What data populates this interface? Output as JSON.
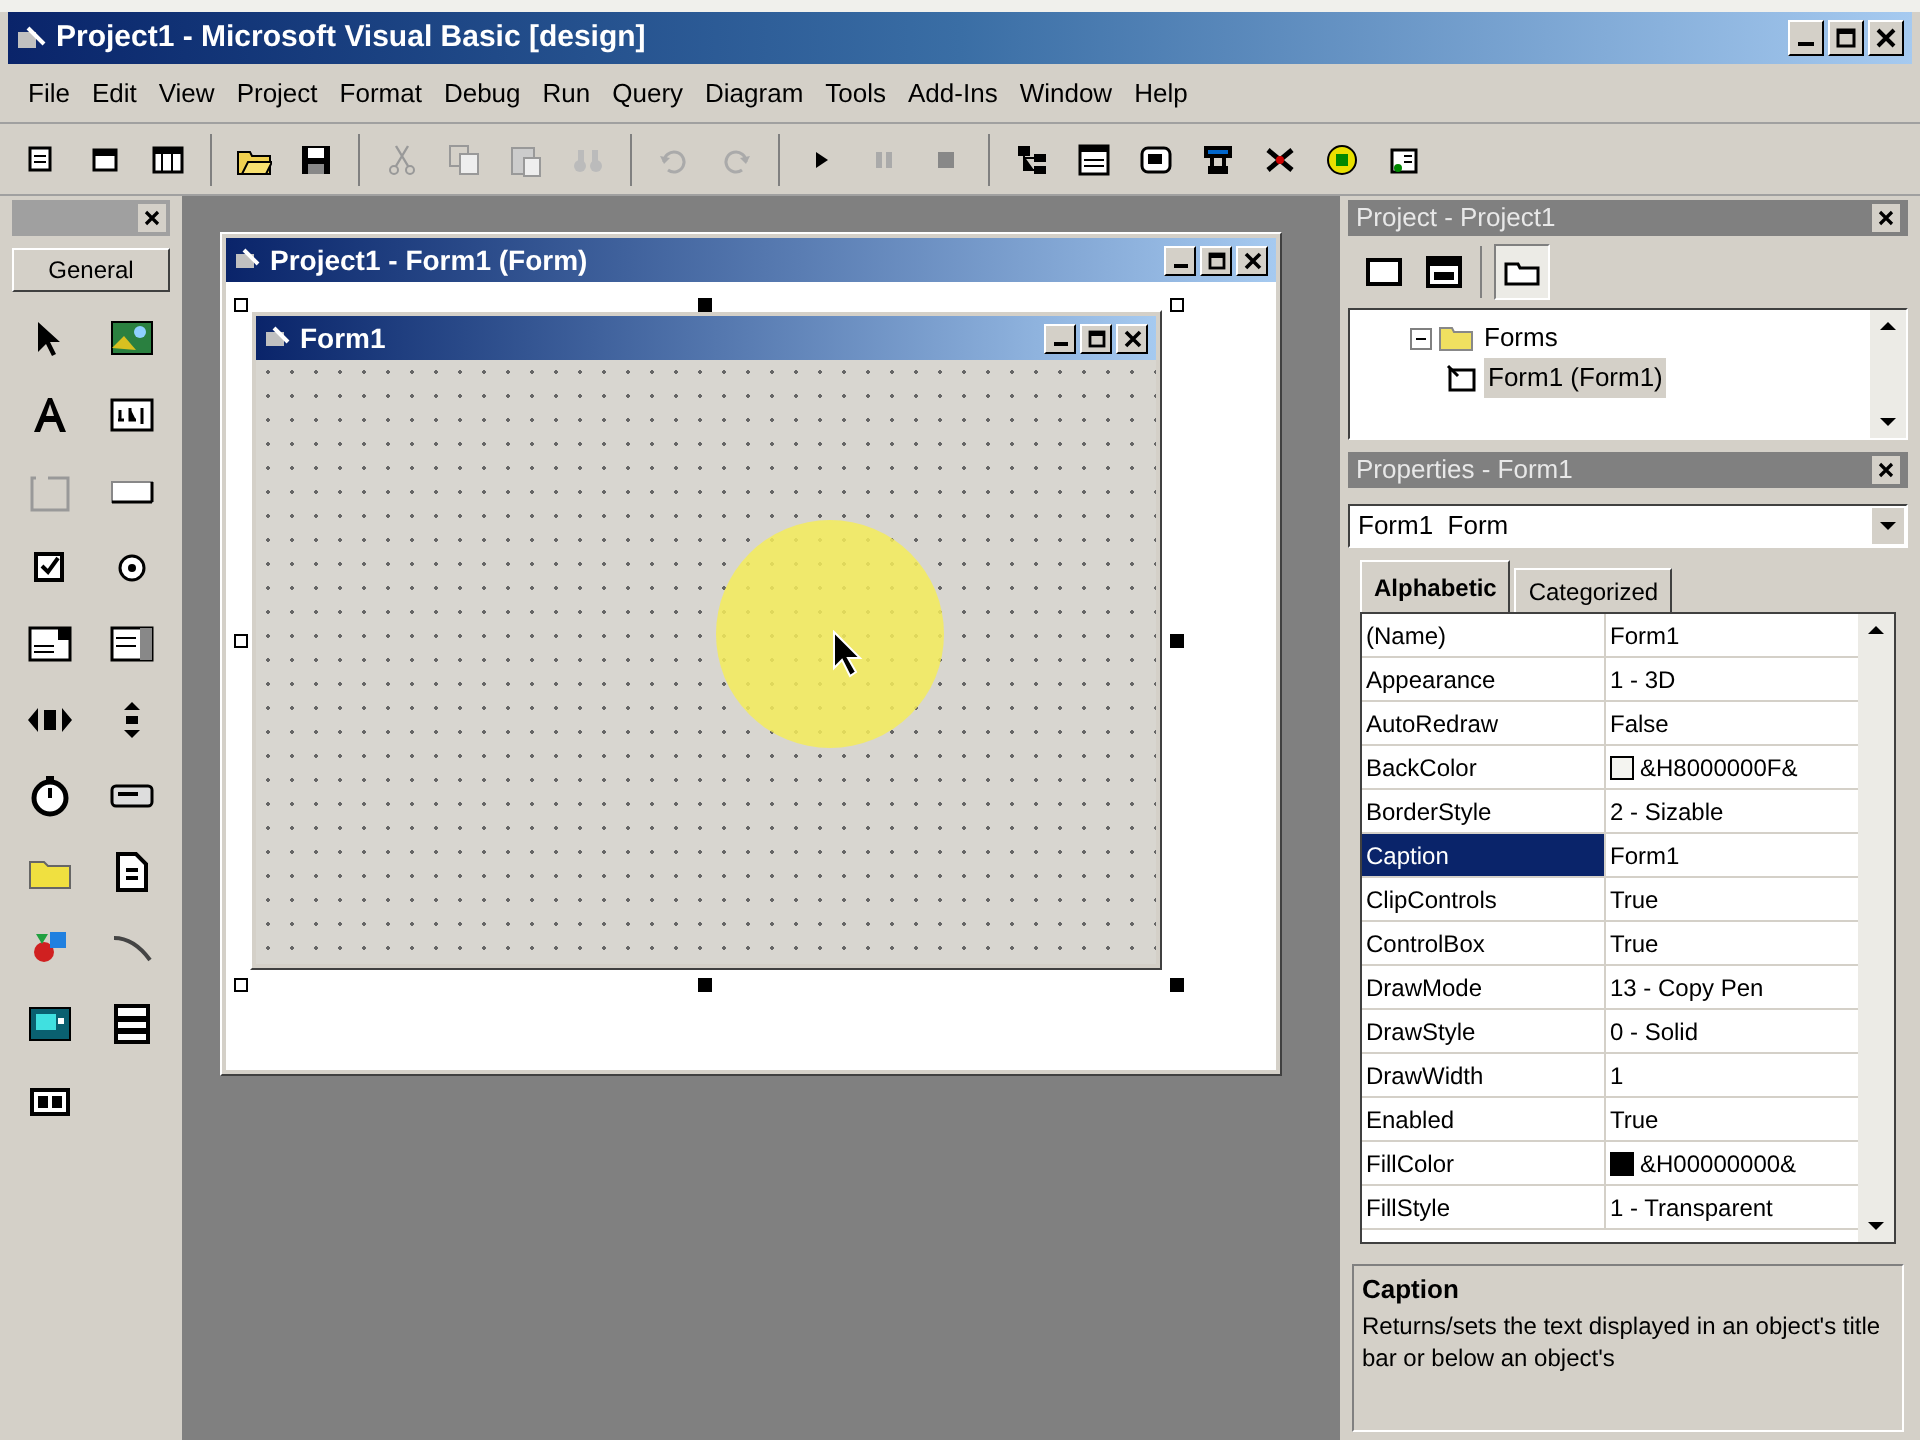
{
  "window": {
    "title": "Project1 - Microsoft Visual Basic [design]"
  },
  "menu": [
    "File",
    "Edit",
    "View",
    "Project",
    "Format",
    "Debug",
    "Run",
    "Query",
    "Diagram",
    "Tools",
    "Add-Ins",
    "Window",
    "Help"
  ],
  "toolbox": {
    "tab": "General"
  },
  "designer": {
    "title": "Project1 - Form1 (Form)",
    "form": {
      "caption": "Form1"
    }
  },
  "project_explorer": {
    "title": "Project - Project1",
    "tree": [
      {
        "label": "Forms",
        "expanded": true,
        "selected": false,
        "children": [
          {
            "label": "Form1 (Form1)",
            "selected": true
          }
        ]
      }
    ]
  },
  "properties": {
    "title": "Properties - Form1",
    "object": "Form1  Form",
    "tabs": [
      {
        "label": "Alphabetic",
        "selected": true
      },
      {
        "label": "Categorized",
        "selected": false
      }
    ],
    "rows": [
      {
        "name": "(Name)",
        "value": "Form1",
        "selected": false
      },
      {
        "name": "Appearance",
        "value": "1 - 3D",
        "selected": false
      },
      {
        "name": "AutoRedraw",
        "value": "False",
        "selected": false
      },
      {
        "name": "BackColor",
        "value": "&H8000000F&",
        "color": "#f4f4f0",
        "selected": false
      },
      {
        "name": "BorderStyle",
        "value": "2 - Sizable",
        "selected": false
      },
      {
        "name": "Caption",
        "value": "Form1",
        "selected": true
      },
      {
        "name": "ClipControls",
        "value": "True",
        "selected": false
      },
      {
        "name": "ControlBox",
        "value": "True",
        "selected": false
      },
      {
        "name": "DrawMode",
        "value": "13 - Copy Pen",
        "selected": false
      },
      {
        "name": "DrawStyle",
        "value": "0 - Solid",
        "selected": false
      },
      {
        "name": "DrawWidth",
        "value": "1",
        "selected": false
      },
      {
        "name": "Enabled",
        "value": "True",
        "selected": false
      },
      {
        "name": "FillColor",
        "value": "&H00000000&",
        "color": "#000000",
        "selected": false
      },
      {
        "name": "FillStyle",
        "value": "1 - Transparent",
        "selected": false
      }
    ],
    "description": {
      "title": "Caption",
      "text": "Returns/sets the text displayed in an object's title bar or below an object's"
    }
  }
}
